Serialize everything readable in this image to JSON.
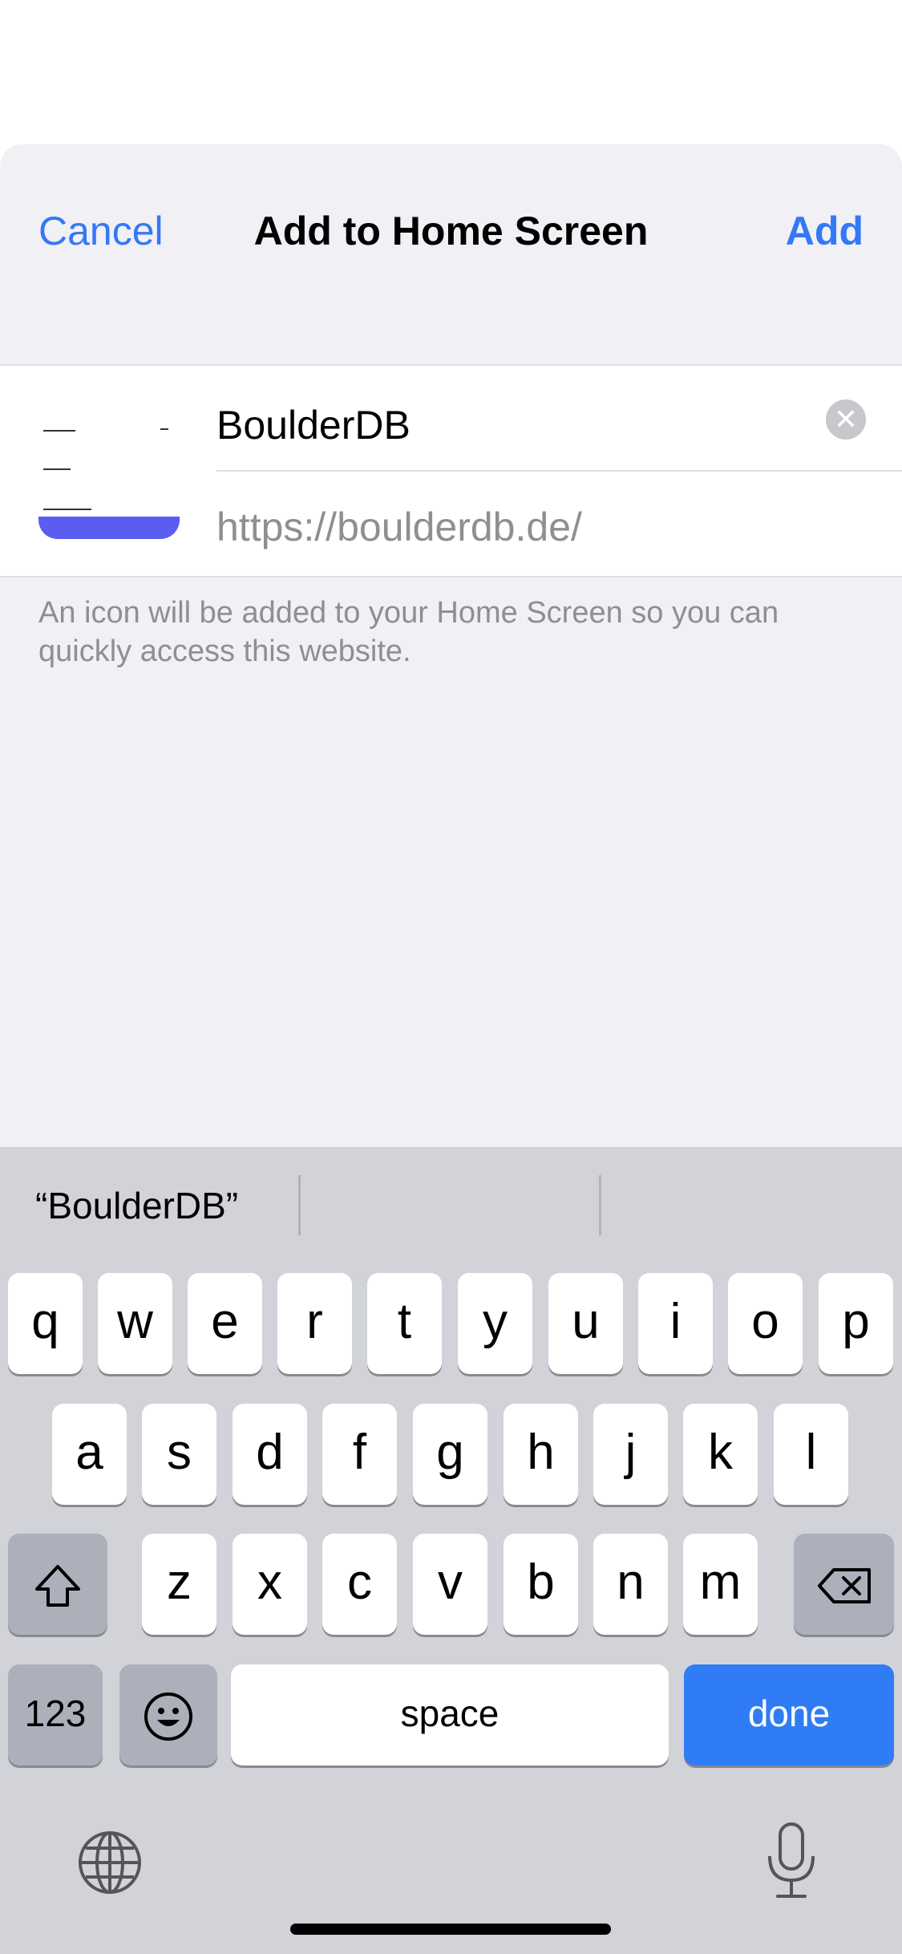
{
  "nav": {
    "cancel": "Cancel",
    "title": "Add to Home Screen",
    "add": "Add"
  },
  "bookmark": {
    "name_value": "BoulderDB",
    "url": "https://boulderdb.de/",
    "clear_icon": "clear-circle-icon"
  },
  "footnote": "An icon will be added to your Home Screen so you can quickly access this website.",
  "keyboard": {
    "suggestion": "“BoulderDB”",
    "row1": [
      "q",
      "w",
      "e",
      "r",
      "t",
      "y",
      "u",
      "i",
      "o",
      "p"
    ],
    "row2": [
      "a",
      "s",
      "d",
      "f",
      "g",
      "h",
      "j",
      "k",
      "l"
    ],
    "row3": [
      "z",
      "x",
      "c",
      "v",
      "b",
      "n",
      "m"
    ],
    "numbers_key": "123",
    "space_key": "space",
    "done_key": "done",
    "shift_icon": "shift-icon",
    "delete_icon": "delete-icon",
    "emoji_icon": "emoji-icon",
    "globe_icon": "globe-icon",
    "mic_icon": "microphone-icon"
  },
  "colors": {
    "accent": "#3478f6",
    "done_key": "#2f7cf6",
    "keyboard_bg": "#d1d3d9",
    "thumb_bar": "#5b5cf0"
  }
}
